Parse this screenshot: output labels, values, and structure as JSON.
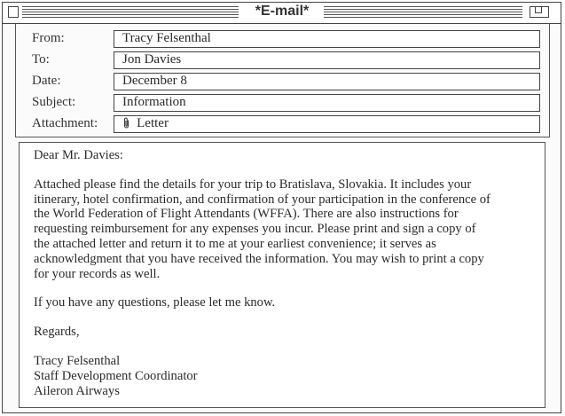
{
  "window": {
    "title": "*E-mail*"
  },
  "header_fields": {
    "from": {
      "label": "From:",
      "value": "Tracy Felsenthal"
    },
    "to": {
      "label": "To:",
      "value": "Jon Davies"
    },
    "date": {
      "label": "Date:",
      "value": "December 8"
    },
    "subject": {
      "label": "Subject:",
      "value": "Information"
    },
    "attachment": {
      "label": "Attachment:",
      "value": "Letter",
      "icon": "paperclip-icon"
    }
  },
  "message": {
    "salutation": "Dear Mr. Davies:",
    "paragraph1_lines": [
      "Attached please find the details for your trip to Bratislava, Slovakia. It includes your",
      "itinerary, hotel confirmation, and confirmation of your participation in the conference of",
      "the World Federation of Flight Attendants (WFFA). There are also instructions for",
      "requesting reimbursement for any expenses you incur. Please print and sign a copy of",
      "the attached letter and return it to me at your earliest convenience; it serves as",
      "acknowledgment that you have received the information. You may wish to print a copy",
      "for your records as well."
    ],
    "paragraph2": "If you have any questions, please let me know.",
    "closing": "Regards,",
    "signature": {
      "name": "Tracy Felsenthal",
      "position": "Staff Development Coordinator",
      "company": "Aileron Airways"
    }
  }
}
